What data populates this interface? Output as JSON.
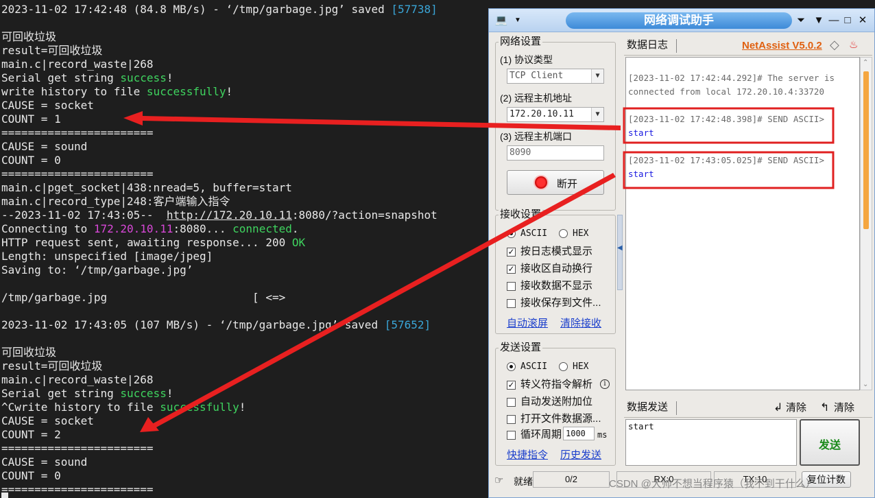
{
  "terminal": {
    "lines": [
      {
        "segments": [
          {
            "text": "2023-11-02 17:42:48 (84.8 MB/s) - ‘/tmp/garbage.jpg’ saved "
          },
          {
            "text": "[57738]",
            "color": "cyan"
          }
        ]
      },
      {
        "segments": []
      },
      {
        "segments": [
          {
            "text": "可回收垃圾"
          }
        ]
      },
      {
        "segments": [
          {
            "text": "result=可回收垃圾"
          }
        ]
      },
      {
        "segments": [
          {
            "text": "main.c|record_waste|268"
          }
        ]
      },
      {
        "segments": [
          {
            "text": "Serial get string "
          },
          {
            "text": "success",
            "color": "green"
          },
          {
            "text": "!"
          }
        ]
      },
      {
        "segments": [
          {
            "text": "write history to file "
          },
          {
            "text": "successfully",
            "color": "green"
          },
          {
            "text": "!"
          }
        ]
      },
      {
        "segments": [
          {
            "text": "CAUSE = socket"
          }
        ]
      },
      {
        "segments": [
          {
            "text": "COUNT = 1"
          }
        ]
      },
      {
        "segments": [
          {
            "text": "======================="
          }
        ]
      },
      {
        "segments": [
          {
            "text": "CAUSE = sound"
          }
        ]
      },
      {
        "segments": [
          {
            "text": "COUNT = 0"
          }
        ]
      },
      {
        "segments": [
          {
            "text": "======================="
          }
        ]
      },
      {
        "segments": [
          {
            "text": "main.c|pget_socket|438:nread=5, buffer=start"
          }
        ]
      },
      {
        "segments": [
          {
            "text": "main.c|record_type|248:客户端输入指令"
          }
        ]
      },
      {
        "segments": [
          {
            "text": "--2023-11-02 17:43:05--  "
          },
          {
            "text": "http://172.20.10.11",
            "color": "link"
          },
          {
            "text": ":8080/?action=snapshot"
          }
        ]
      },
      {
        "segments": [
          {
            "text": "Connecting to "
          },
          {
            "text": "172.20.10.11",
            "color": "magenta"
          },
          {
            "text": ":8080... "
          },
          {
            "text": "connected",
            "color": "green"
          },
          {
            "text": "."
          }
        ]
      },
      {
        "segments": [
          {
            "text": "HTTP request sent, awaiting response... 200 "
          },
          {
            "text": "OK",
            "color": "green"
          }
        ]
      },
      {
        "segments": [
          {
            "text": "Length: unspecified [image/jpeg]"
          }
        ]
      },
      {
        "segments": [
          {
            "text": "Saving to: ‘/tmp/garbage.jpg’"
          }
        ]
      },
      {
        "segments": []
      },
      {
        "segments": [
          {
            "text": "/tmp/garbage.jpg                      [ <=>"
          }
        ]
      },
      {
        "segments": []
      },
      {
        "segments": [
          {
            "text": "2023-11-02 17:43:05 (107 MB/s) - ‘/tmp/garbage.jpg’ saved "
          },
          {
            "text": "[57652]",
            "color": "cyan"
          }
        ]
      },
      {
        "segments": []
      },
      {
        "segments": [
          {
            "text": "可回收垃圾"
          }
        ]
      },
      {
        "segments": [
          {
            "text": "result=可回收垃圾"
          }
        ]
      },
      {
        "segments": [
          {
            "text": "main.c|record_waste|268"
          }
        ]
      },
      {
        "segments": [
          {
            "text": "Serial get string "
          },
          {
            "text": "success",
            "color": "green"
          },
          {
            "text": "!"
          }
        ]
      },
      {
        "segments": [
          {
            "text": "^Cwrite history to file "
          },
          {
            "text": "successfully",
            "color": "green"
          },
          {
            "text": "!"
          }
        ]
      },
      {
        "segments": [
          {
            "text": "CAUSE = socket"
          }
        ]
      },
      {
        "segments": [
          {
            "text": "COUNT = 2"
          }
        ]
      },
      {
        "segments": [
          {
            "text": "======================="
          }
        ]
      },
      {
        "segments": [
          {
            "text": "CAUSE = sound"
          }
        ]
      },
      {
        "segments": [
          {
            "text": "COUNT = 0"
          }
        ]
      },
      {
        "segments": [
          {
            "text": "======================="
          }
        ]
      }
    ]
  },
  "app": {
    "title": "网络调试助手",
    "brand": "NetAssist V5.0.2",
    "icons": {
      "app": "computer-icon",
      "menu": "dropdown-icon",
      "pin": "pin-icon",
      "minimize": "minimize-icon",
      "maximize": "maximize-icon",
      "close": "close-icon",
      "diamond": "diamond-icon",
      "bell": "bell-icon"
    },
    "net_settings": {
      "title": "网络设置",
      "protocol_label": "(1) 协议类型",
      "protocol_value": "TCP Client",
      "host_label": "(2) 远程主机地址",
      "host_value": "172.20.10.11",
      "port_label": "(3) 远程主机端口",
      "port_value": "8090",
      "disconnect_label": "断开"
    },
    "recv_settings": {
      "title": "接收设置",
      "ascii": "ASCII",
      "hex": "HEX",
      "options": [
        {
          "label": "按日志模式显示",
          "checked": true
        },
        {
          "label": "接收区自动换行",
          "checked": true
        },
        {
          "label": "接收数据不显示",
          "checked": false
        },
        {
          "label": "接收保存到文件...",
          "checked": false
        }
      ],
      "auto_scroll": "自动滚屏",
      "clear_recv": "清除接收"
    },
    "send_settings": {
      "title": "发送设置",
      "ascii": "ASCII",
      "hex": "HEX",
      "options": [
        {
          "label": "转义符指令解析",
          "checked": true
        },
        {
          "label": "自动发送附加位",
          "checked": false
        },
        {
          "label": "打开文件数据源...",
          "checked": false
        }
      ],
      "loop_label": "循环周期",
      "loop_value": "1000",
      "loop_unit": "ms",
      "shortcut": "快捷指令",
      "history": "历史发送"
    },
    "log": {
      "tab": "数据日志",
      "entries": [
        {
          "header": "[2023-11-02 17:42:44.292]# The server is",
          "header2": "connected from local 172.20.10.4:33720",
          "data": ""
        },
        {
          "header": "[2023-11-02 17:42:48.398]# SEND ASCII>",
          "header2": "",
          "data": "start"
        },
        {
          "header": "[2023-11-02 17:43:05.025]# SEND ASCII>",
          "header2": "",
          "data": "start"
        }
      ]
    },
    "send": {
      "tab": "数据发送",
      "clear1": "清除",
      "clear2": "清除",
      "content": "start",
      "send_button": "发送"
    },
    "status": {
      "ready": "就绪",
      "count": "0/2",
      "rx": "RX:0",
      "tx": "TX:10",
      "reset": "复位计数"
    }
  },
  "watermark": "CSDN @大帅不想当程序猿（我不到干什么）",
  "colors": {
    "green": "#3fd45f",
    "cyan": "#3aa6d8",
    "magenta": "#d948d9",
    "arrow": "#e82020",
    "brand": "#e06010",
    "link": "#1a3ecc"
  }
}
